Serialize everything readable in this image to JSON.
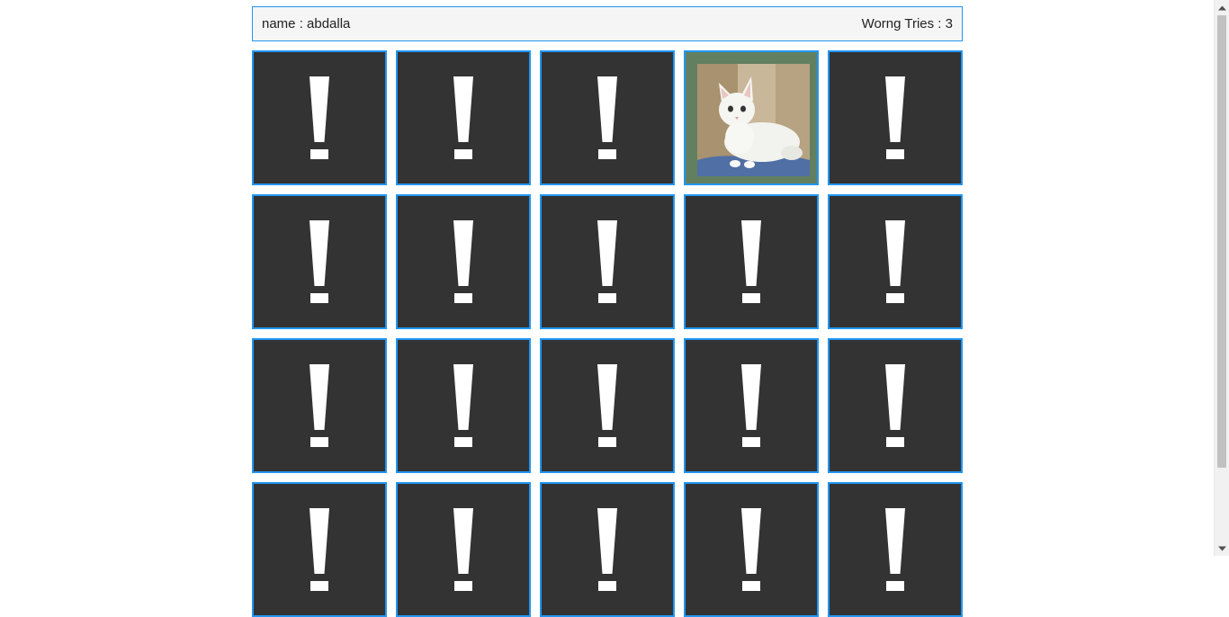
{
  "player": {
    "name_text": "name : abdalla"
  },
  "stats": {
    "wrong_tries_text": "Worng Tries : 3"
  },
  "board": {
    "columns": 5,
    "cards": [
      {
        "state": "hidden",
        "icon": "exclamation-icon"
      },
      {
        "state": "hidden",
        "icon": "exclamation-icon"
      },
      {
        "state": "hidden",
        "icon": "exclamation-icon"
      },
      {
        "state": "flipped",
        "icon": "cat-image"
      },
      {
        "state": "hidden",
        "icon": "exclamation-icon"
      },
      {
        "state": "hidden",
        "icon": "exclamation-icon"
      },
      {
        "state": "hidden",
        "icon": "exclamation-icon"
      },
      {
        "state": "hidden",
        "icon": "exclamation-icon"
      },
      {
        "state": "hidden",
        "icon": "exclamation-icon"
      },
      {
        "state": "hidden",
        "icon": "exclamation-icon"
      },
      {
        "state": "hidden",
        "icon": "exclamation-icon"
      },
      {
        "state": "hidden",
        "icon": "exclamation-icon"
      },
      {
        "state": "hidden",
        "icon": "exclamation-icon"
      },
      {
        "state": "hidden",
        "icon": "exclamation-icon"
      },
      {
        "state": "hidden",
        "icon": "exclamation-icon"
      },
      {
        "state": "hidden",
        "icon": "exclamation-icon"
      },
      {
        "state": "hidden",
        "icon": "exclamation-icon"
      },
      {
        "state": "hidden",
        "icon": "exclamation-icon"
      },
      {
        "state": "hidden",
        "icon": "exclamation-icon"
      },
      {
        "state": "hidden",
        "icon": "exclamation-icon"
      }
    ]
  },
  "colors": {
    "card_back": "#333333",
    "card_border": "#2196f3",
    "flipped_background": "#62805f",
    "info_background": "#f5f5f5"
  }
}
